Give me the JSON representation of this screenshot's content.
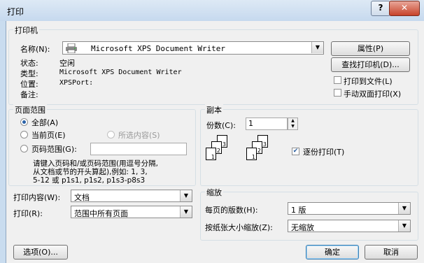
{
  "window": {
    "title": "打印",
    "help_label": "?",
    "close_label": "✕"
  },
  "printer": {
    "group_label": "打印机",
    "name_label": "名称(N):",
    "name_value": "Microsoft XPS Document Writer",
    "status_label": "状态:",
    "status_value": "空闲",
    "type_label": "类型:",
    "type_value": "Microsoft XPS Document Writer",
    "location_label": "位置:",
    "location_value": "XPSPort:",
    "comment_label": "备注:",
    "properties_button": "属性(P)",
    "find_printer_button": "查找打印机(D)...",
    "print_to_file": "打印到文件(L)",
    "manual_duplex": "手动双面打印(X)"
  },
  "page_range": {
    "group_label": "页面范围",
    "all": "全部(A)",
    "current_page": "当前页(E)",
    "selection": "所选内容(S)",
    "pages": "页码范围(G):",
    "hint_line1": "请键入页码和/或页码范围(用逗号分隔,",
    "hint_line2": "从文档或节的开头算起),例如: 1, 3,",
    "hint_line3": "5-12 或 p1s1, p1s2, p1s3-p8s3"
  },
  "copies": {
    "group_label": "副本",
    "count_label": "份数(C):",
    "count_value": "1",
    "collate": "逐份打印(T)",
    "page_labels": [
      "1",
      "2",
      "3"
    ]
  },
  "print_what": {
    "label": "打印内容(W):",
    "value": "文档"
  },
  "print": {
    "label": "打印(R):",
    "value": "范围中所有页面"
  },
  "zoom": {
    "group_label": "缩放",
    "pages_per_sheet_label": "每页的版数(H):",
    "pages_per_sheet_value": "1 版",
    "scale_label": "按纸张大小缩放(Z):",
    "scale_value": "无缩放"
  },
  "footer": {
    "options_button": "选项(O)...",
    "ok_button": "确定",
    "cancel_button": "取消"
  }
}
